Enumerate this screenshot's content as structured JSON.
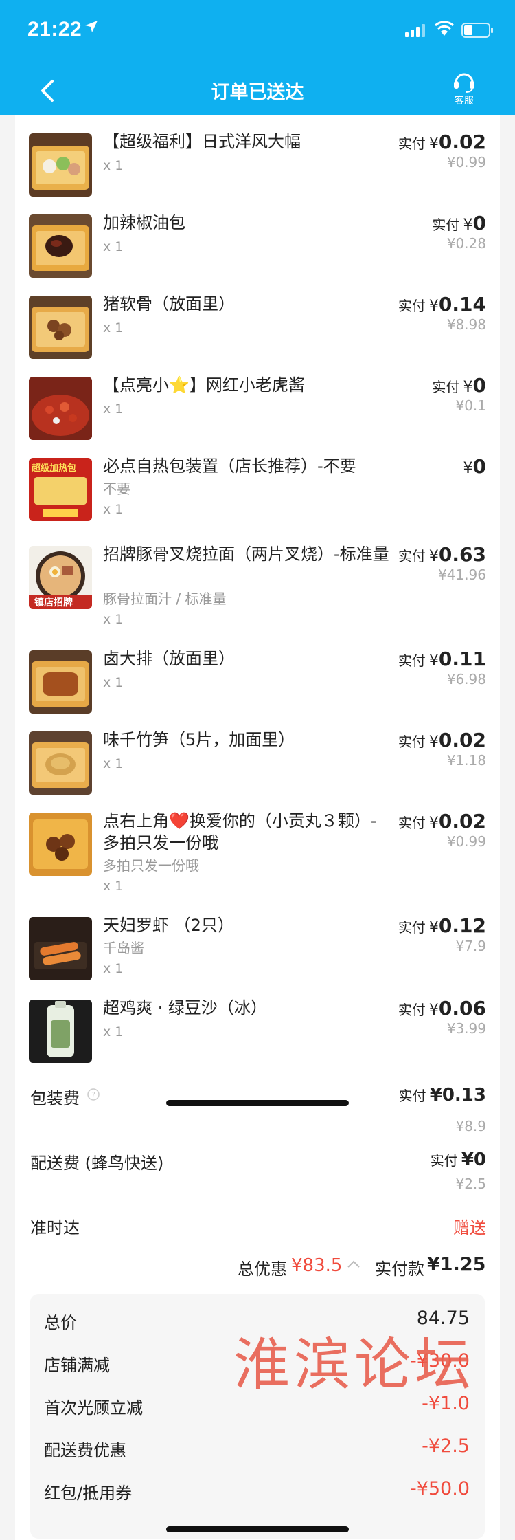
{
  "status_bar": {
    "time": "21:22"
  },
  "nav": {
    "title": "订单已送达",
    "service_label": "客服"
  },
  "items": [
    {
      "name": "【超级福利】日式洋风大幅",
      "qty": "x 1",
      "paid_label": "实付",
      "currency": "¥",
      "paid": "0.02",
      "original": "¥0.99",
      "thumb": "dessert-plate"
    },
    {
      "name": "加辣椒油包",
      "qty": "x 1",
      "paid_label": "实付",
      "currency": "¥",
      "paid": "0",
      "original": "¥0.28",
      "thumb": "chili-oil"
    },
    {
      "name": "猪软骨（放面里）",
      "qty": "x 1",
      "paid_label": "实付",
      "currency": "¥",
      "paid": "0.14",
      "original": "¥8.98",
      "thumb": "pork-cartilage"
    },
    {
      "name": "【点亮小⭐】网红小老虎酱",
      "qty": "x 1",
      "paid_label": "实付",
      "currency": "¥",
      "paid": "0",
      "original": "¥0.1",
      "thumb": "tiger-sauce"
    },
    {
      "name": "必点自热包装置（店长推荐）-不要",
      "spec": "不要",
      "qty": "x 1",
      "paid_label": "",
      "currency": "¥",
      "paid": "0",
      "original": "",
      "thumb": "heating-pack",
      "thumb_text": "超级加热包"
    },
    {
      "name": "招牌豚骨叉烧拉面（两片叉烧）-标准量",
      "spec": "豚骨拉面汁 / 标准量",
      "qty": "x 1",
      "paid_label": "实付",
      "currency": "¥",
      "paid": "0.63",
      "original": "¥41.96",
      "thumb": "ramen",
      "thumb_text": "镇店招牌"
    },
    {
      "name": "卤大排（放面里）",
      "qty": "x 1",
      "paid_label": "实付",
      "currency": "¥",
      "paid": "0.11",
      "original": "¥6.98",
      "thumb": "pork-chop"
    },
    {
      "name": "味千竹笋（5片，加面里）",
      "qty": "x 1",
      "paid_label": "实付",
      "currency": "¥",
      "paid": "0.02",
      "original": "¥1.18",
      "thumb": "bamboo-shoots"
    },
    {
      "name": "点右上角❤️换爱你的（小贡丸３颗）-多拍只发一份哦",
      "spec": "多拍只发一份哦",
      "qty": "x 1",
      "paid_label": "实付",
      "currency": "¥",
      "paid": "0.02",
      "original": "¥0.99",
      "thumb": "meatballs"
    },
    {
      "name": "天妇罗虾 （2只）",
      "spec": "千岛酱",
      "qty": "x 1",
      "paid_label": "实付",
      "currency": "¥",
      "paid": "0.12",
      "original": "¥7.9",
      "thumb": "tempura-shrimp"
    },
    {
      "name": "超鸡爽 · 绿豆沙（冰）",
      "qty": "x 1",
      "paid_label": "实付",
      "currency": "¥",
      "paid": "0.06",
      "original": "¥3.99",
      "thumb": "mung-bean-drink"
    }
  ],
  "fees": {
    "packaging": {
      "label": "包装费",
      "paid_label": "实付",
      "paid": "¥0.13",
      "original": "¥8.9"
    },
    "delivery": {
      "label": "配送费 (蜂鸟快送)",
      "paid_label": "实付",
      "paid": "¥0",
      "original": "¥2.5"
    },
    "ontime": {
      "label": "准时达",
      "value": "赠送"
    }
  },
  "summary": {
    "discount_label": "总优惠",
    "discount_value": "¥83.5",
    "actual_label": "实付款",
    "actual_value": "¥1.25"
  },
  "bill": [
    {
      "label": "总价",
      "value": "84.75",
      "color": "#222222"
    },
    {
      "label": "店铺满减",
      "value": "-¥30.0",
      "color": "#f04b3d"
    },
    {
      "label": "首次光顾立减",
      "value": "-¥1.0",
      "color": "#f04b3d"
    },
    {
      "label": "配送费优惠",
      "value": "-¥2.5",
      "color": "#f04b3d"
    },
    {
      "label": "红包/抵用券",
      "value": "-¥50.0",
      "color": "#f04b3d"
    }
  ],
  "watermark": "淮滨论坛",
  "colors": {
    "brand": "#0fb0f0",
    "accent_red": "#f04b3d"
  }
}
